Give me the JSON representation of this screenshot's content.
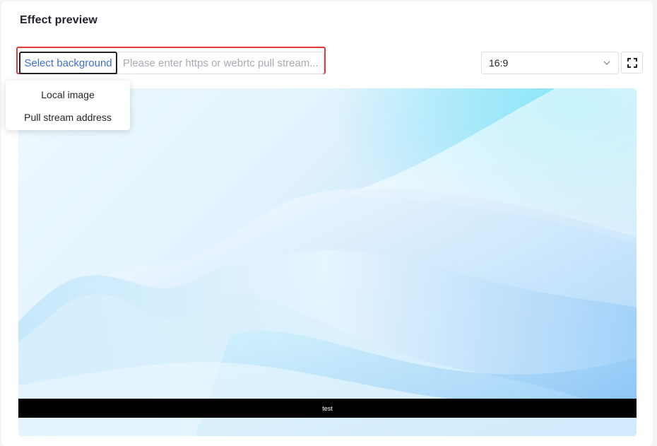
{
  "section": {
    "title": "Effect preview"
  },
  "toolbar": {
    "select_background_label": "Select background",
    "stream_input": {
      "value": "",
      "placeholder": "Please enter https or webrtc pull stream..."
    },
    "aspect_ratio": {
      "selected": "16:9"
    },
    "icons": {
      "ratio_dropdown": "chevron-down-icon",
      "fullscreen": "fullscreen-icon"
    }
  },
  "background_menu": {
    "items": [
      {
        "label": "Local image"
      },
      {
        "label": "Pull stream address"
      }
    ]
  },
  "preview": {
    "caption": "test"
  },
  "colors": {
    "accent": "#3f6fd1",
    "highlight_frame": "#e53935",
    "caption_bar": "#000000"
  }
}
